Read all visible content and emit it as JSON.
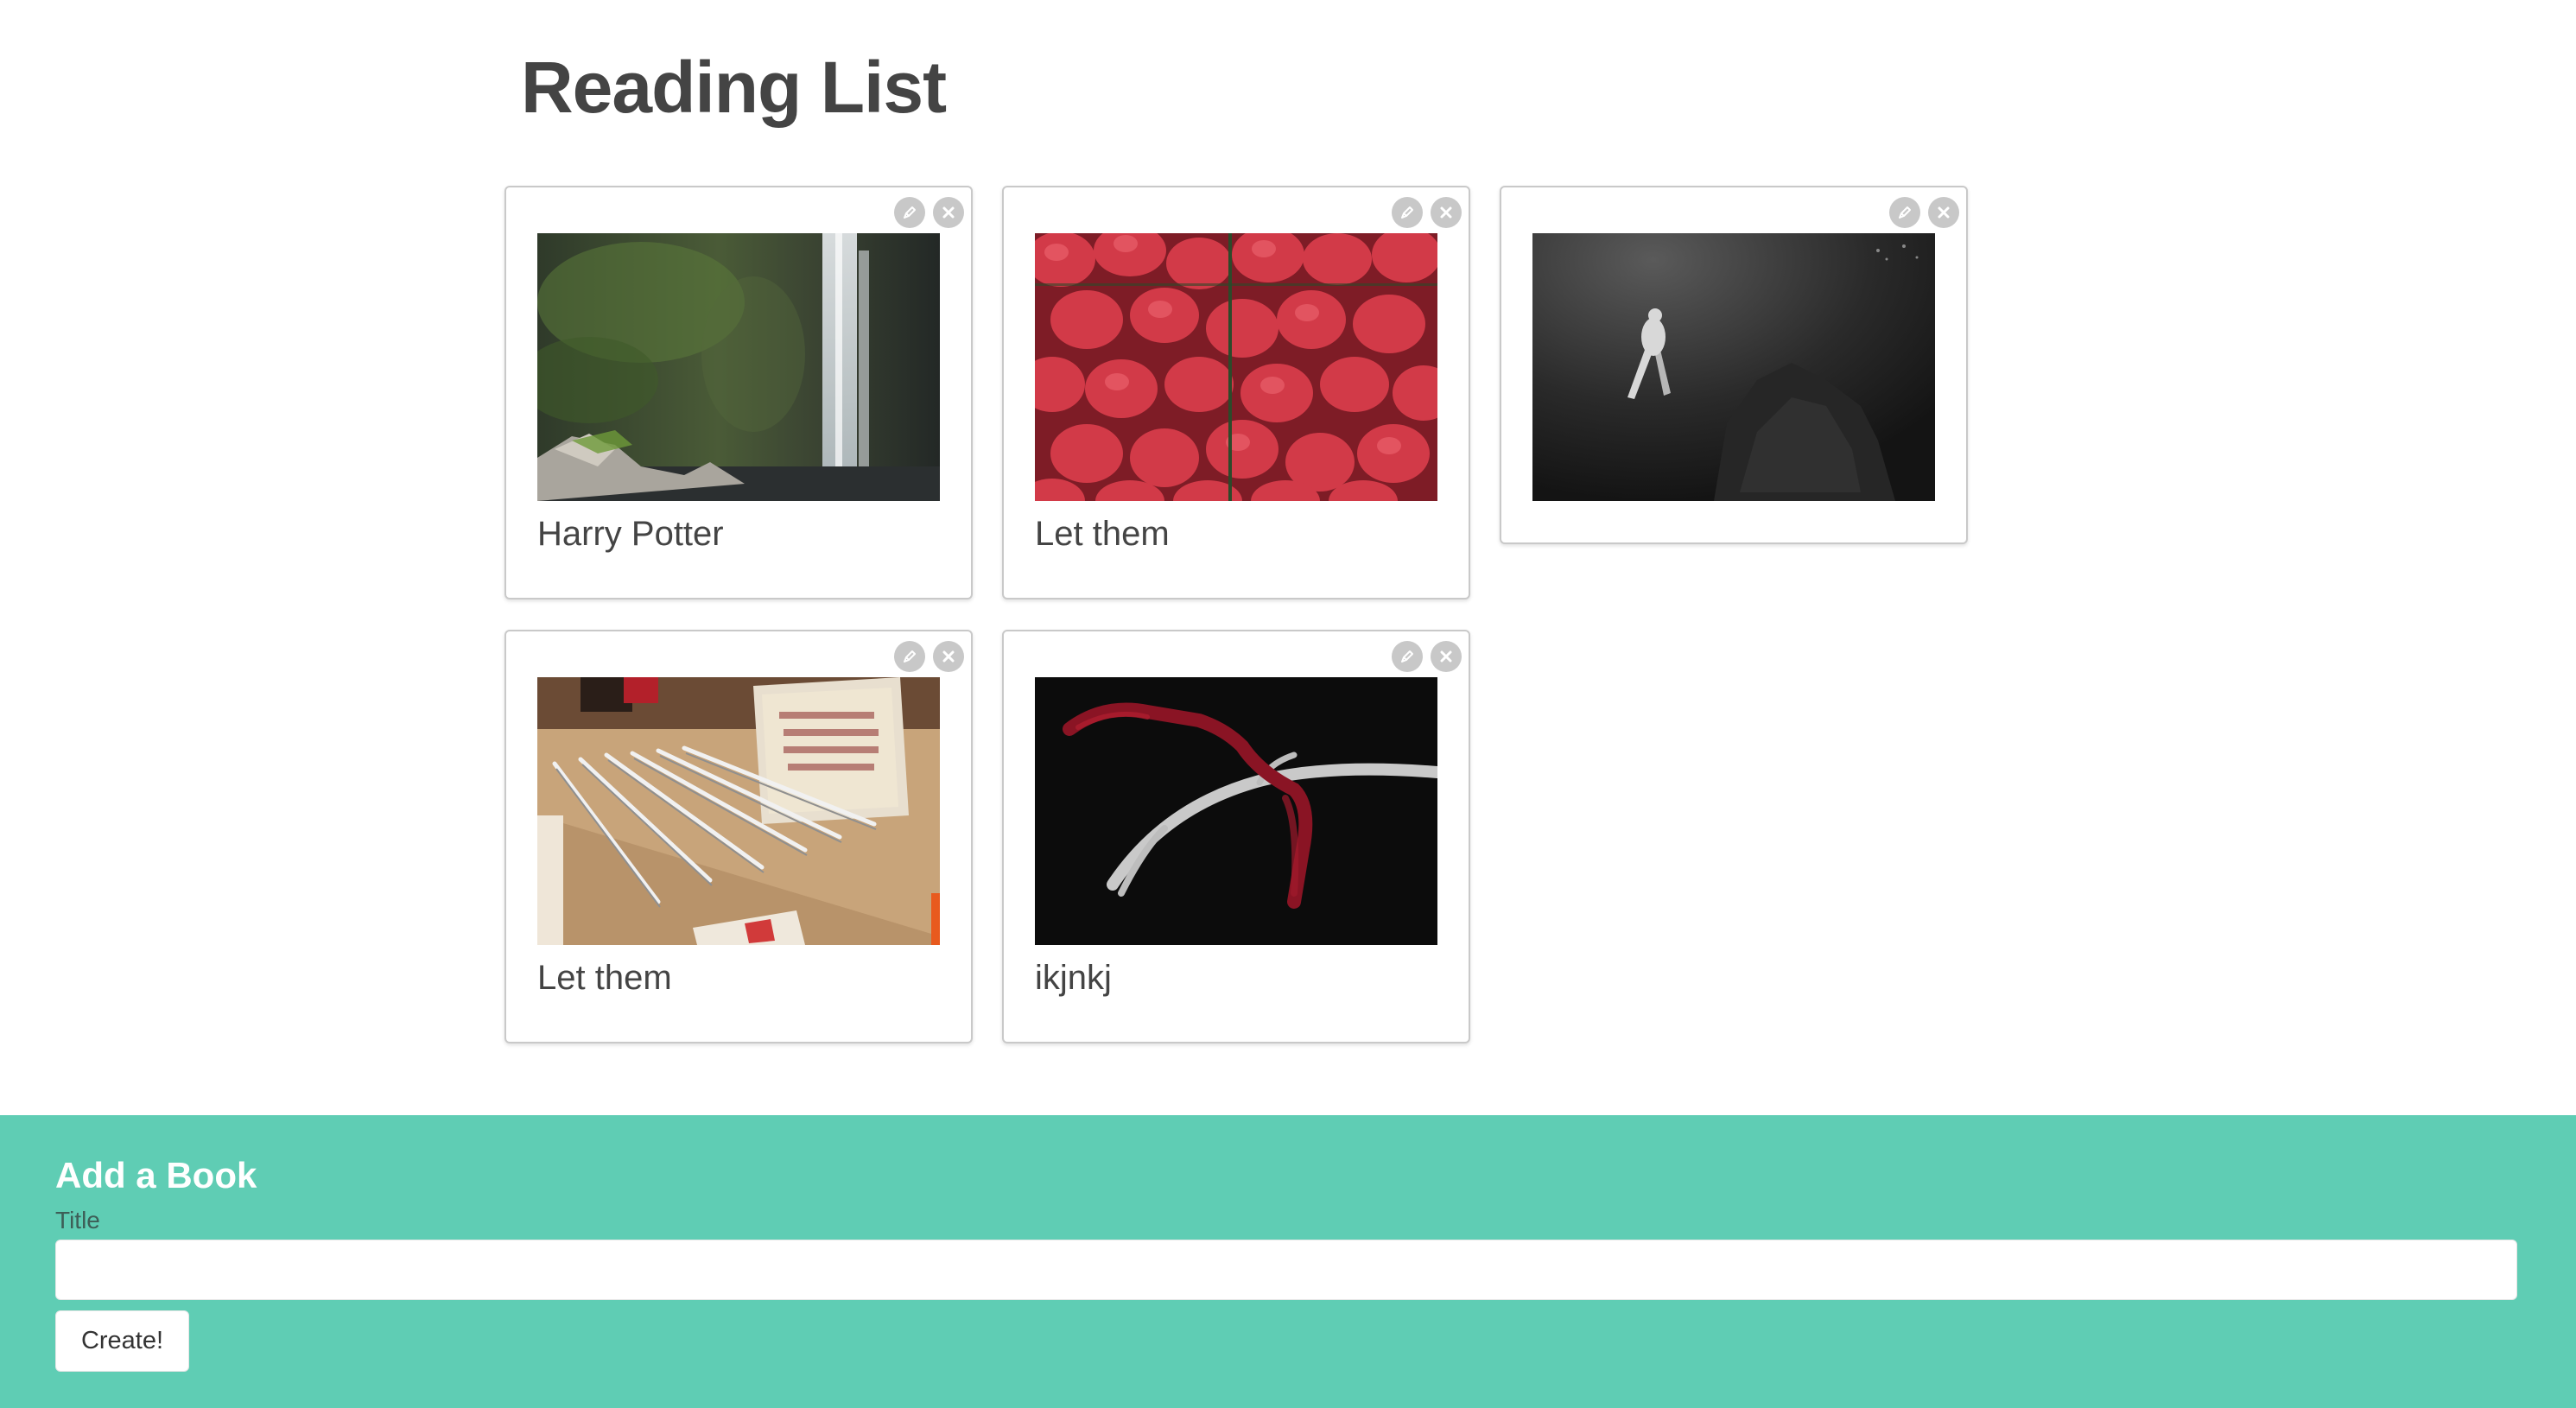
{
  "header": {
    "title": "Reading List"
  },
  "books": [
    {
      "title": "Harry Potter",
      "cover": "waterfall-photo",
      "edit_icon": "pencil-icon",
      "delete_icon": "close-icon"
    },
    {
      "title": "Let them",
      "cover": "strawberries-photo",
      "edit_icon": "pencil-icon",
      "delete_icon": "close-icon"
    },
    {
      "title": "",
      "cover": "scuba-diver-photo",
      "edit_icon": "pencil-icon",
      "delete_icon": "close-icon"
    },
    {
      "title": "Let them",
      "cover": "pencils-photo",
      "edit_icon": "pencil-icon",
      "delete_icon": "close-icon"
    },
    {
      "title": "ikjnkj",
      "cover": "antler-ribbon-photo",
      "edit_icon": "pencil-icon",
      "delete_icon": "close-icon"
    }
  ],
  "add_book": {
    "heading": "Add a Book",
    "title_label": "Title",
    "title_value": "",
    "title_placeholder": "",
    "create_label": "Create!"
  },
  "colors": {
    "accent": "#5fcdb4",
    "text": "#444444",
    "card_border": "#c9c9c9",
    "action_button": "#c8c8c8"
  }
}
